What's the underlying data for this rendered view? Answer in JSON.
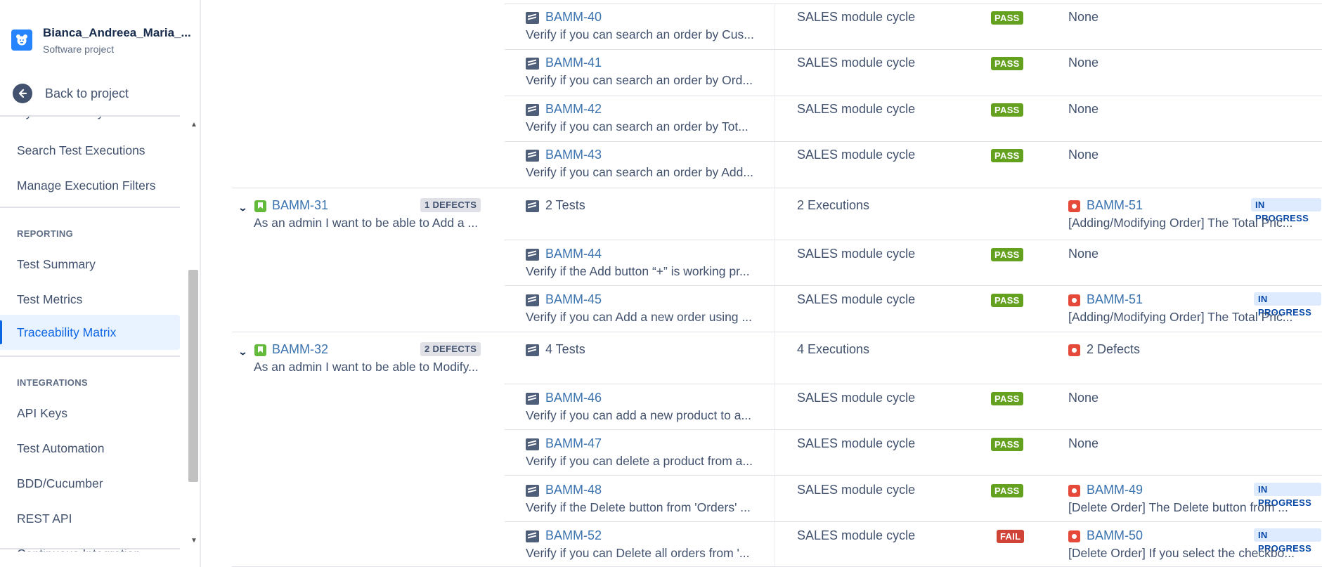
{
  "project": {
    "name": "Bianca_Andreea_Maria_...",
    "type": "Software project",
    "back_label": "Back to project"
  },
  "nav": {
    "cut_item": "Cycle Summary",
    "items_top": [
      "Search Test Executions",
      "Manage Execution Filters"
    ],
    "reporting_heading": "REPORTING",
    "reporting_items": [
      "Test Summary",
      "Test Metrics",
      "Traceability Matrix"
    ],
    "active_item": "Traceability Matrix",
    "integrations_heading": "INTEGRATIONS",
    "integration_items": [
      "API Keys",
      "Test Automation",
      "BDD/Cucumber",
      "REST API"
    ],
    "cut_bottom_item": "Continuous Integration"
  },
  "icons": {
    "project_avatar": "project-avatar-icon",
    "back": "arrow-left-icon",
    "story": "story-icon",
    "test": "test-icon",
    "bug": "bug-icon",
    "chevron": "chevron-down-icon"
  },
  "colors": {
    "pass": "#63a11e",
    "fail": "#d04437",
    "in_progress_bg": "#deebff",
    "link": "#3b73af",
    "story": "#63ba3c",
    "bug": "#e5493a"
  },
  "rows": {
    "t40": {
      "key": "BAMM-40",
      "summary": "Verify if you can search an order by Cus...",
      "exec": "SALES module cycle",
      "status": "PASS",
      "defect": "None"
    },
    "t41": {
      "key": "BAMM-41",
      "summary": "Verify if you can search an order by Ord...",
      "exec": "SALES module cycle",
      "status": "PASS",
      "defect": "None"
    },
    "t42": {
      "key": "BAMM-42",
      "summary": "Verify if you can search an order by Tot...",
      "exec": "SALES module cycle",
      "status": "PASS",
      "defect": "None"
    },
    "t43": {
      "key": "BAMM-43",
      "summary": "Verify if you can search an order by Add...",
      "exec": "SALES module cycle",
      "status": "PASS",
      "defect": "None"
    },
    "r31": {
      "key": "BAMM-31",
      "badge": "1 DEFECTS",
      "summary": "As an admin I want to be able to Add a ...",
      "tests": "2 Tests",
      "execs": "2 Executions",
      "defect_key": "BAMM-51",
      "defect_status": "IN PROGRESS",
      "defect_summary": "[Adding/Modifying Order] The Total Pric..."
    },
    "t44": {
      "key": "BAMM-44",
      "summary": "Verify if the Add button “+” is working pr...",
      "exec": "SALES module cycle",
      "status": "PASS",
      "defect": "None"
    },
    "t45": {
      "key": "BAMM-45",
      "summary": "Verify if you can Add a new order using ...",
      "exec": "SALES module cycle",
      "status": "PASS",
      "defect_key": "BAMM-51",
      "defect_status": "IN PROGRESS",
      "defect_summary": "[Adding/Modifying Order] The Total Pric..."
    },
    "r32": {
      "key": "BAMM-32",
      "badge": "2 DEFECTS",
      "summary": "As an admin I want to be able to Modify...",
      "tests": "4 Tests",
      "execs": "4 Executions",
      "defects": "2 Defects"
    },
    "t46": {
      "key": "BAMM-46",
      "summary": "Verify if you can add a new product to a...",
      "exec": "SALES module cycle",
      "status": "PASS",
      "defect": "None"
    },
    "t47": {
      "key": "BAMM-47",
      "summary": "Verify if you can delete a product from a...",
      "exec": "SALES module cycle",
      "status": "PASS",
      "defect": "None"
    },
    "t48": {
      "key": "BAMM-48",
      "summary": "Verify if the Delete button from 'Orders' ...",
      "exec": "SALES module cycle",
      "status": "PASS",
      "defect_key": "BAMM-49",
      "defect_status": "IN PROGRESS",
      "defect_summary": "[Delete Order] The Delete button from ..."
    },
    "t52": {
      "key": "BAMM-52",
      "summary": "Verify if you can Delete all orders from '...",
      "exec": "SALES module cycle",
      "status": "FAIL",
      "defect_key": "BAMM-50",
      "defect_status": "IN PROGRESS",
      "defect_summary": "[Delete Order] If you select the checkbo..."
    }
  }
}
